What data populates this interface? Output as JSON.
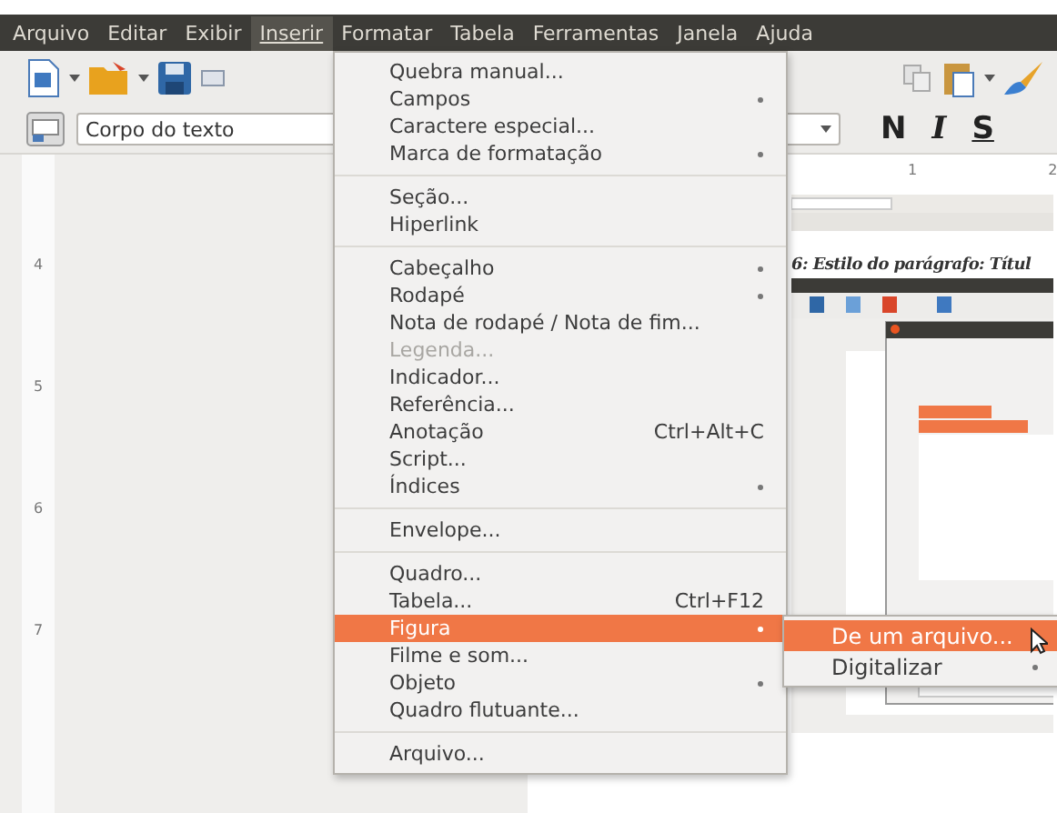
{
  "menubar": [
    {
      "label": "Arquivo",
      "selected": false
    },
    {
      "label": "Editar",
      "selected": false
    },
    {
      "label": "Exibir",
      "selected": false
    },
    {
      "label": "Inserir",
      "selected": true
    },
    {
      "label": "Formatar",
      "selected": false
    },
    {
      "label": "Tabela",
      "selected": false
    },
    {
      "label": "Ferramentas",
      "selected": false
    },
    {
      "label": "Janela",
      "selected": false
    },
    {
      "label": "Ajuda",
      "selected": false
    }
  ],
  "formatting_bar": {
    "paragraph_style": "Corpo do texto",
    "bold": "N",
    "italic": "I",
    "underline": "S"
  },
  "ruler": {
    "top_ticks": [
      "1",
      "2"
    ],
    "left_ticks": [
      "4",
      "5",
      "6",
      "7"
    ]
  },
  "document": {
    "caption": "6: Estilo do parágrafo: Títul"
  },
  "insert_menu": [
    {
      "kind": "item",
      "label": "Quebra manual...",
      "submenu": false,
      "disabled": false,
      "selected": false
    },
    {
      "kind": "item",
      "label": "Campos",
      "submenu": true,
      "disabled": false,
      "selected": false
    },
    {
      "kind": "item",
      "label": "Caractere especial...",
      "submenu": false,
      "disabled": false,
      "selected": false
    },
    {
      "kind": "item",
      "label": "Marca de formatação",
      "submenu": true,
      "disabled": false,
      "selected": false
    },
    {
      "kind": "separator"
    },
    {
      "kind": "item",
      "label": "Seção...",
      "submenu": false,
      "disabled": false,
      "selected": false
    },
    {
      "kind": "item",
      "label": "Hiperlink",
      "submenu": false,
      "disabled": false,
      "selected": false
    },
    {
      "kind": "separator"
    },
    {
      "kind": "item",
      "label": "Cabeçalho",
      "submenu": true,
      "disabled": false,
      "selected": false
    },
    {
      "kind": "item",
      "label": "Rodapé",
      "submenu": true,
      "disabled": false,
      "selected": false
    },
    {
      "kind": "item",
      "label": "Nota de rodapé / Nota de fim...",
      "submenu": false,
      "disabled": false,
      "selected": false
    },
    {
      "kind": "item",
      "label": "Legenda...",
      "submenu": false,
      "disabled": true,
      "selected": false
    },
    {
      "kind": "item",
      "label": "Indicador...",
      "submenu": false,
      "disabled": false,
      "selected": false
    },
    {
      "kind": "item",
      "label": "Referência...",
      "submenu": false,
      "disabled": false,
      "selected": false
    },
    {
      "kind": "item",
      "label": "Anotação",
      "shortcut": "Ctrl+Alt+C",
      "submenu": false,
      "disabled": false,
      "selected": false
    },
    {
      "kind": "item",
      "label": "Script...",
      "submenu": false,
      "disabled": false,
      "selected": false
    },
    {
      "kind": "item",
      "label": "Índices",
      "submenu": true,
      "disabled": false,
      "selected": false
    },
    {
      "kind": "separator"
    },
    {
      "kind": "item",
      "label": "Envelope...",
      "submenu": false,
      "disabled": false,
      "selected": false
    },
    {
      "kind": "separator"
    },
    {
      "kind": "item",
      "label": "Quadro...",
      "submenu": false,
      "disabled": false,
      "selected": false
    },
    {
      "kind": "item",
      "label": "Tabela...",
      "shortcut": "Ctrl+F12",
      "submenu": false,
      "disabled": false,
      "selected": false
    },
    {
      "kind": "item",
      "label": "Figura",
      "submenu": true,
      "disabled": false,
      "selected": true
    },
    {
      "kind": "item",
      "label": "Filme e som...",
      "submenu": false,
      "disabled": false,
      "selected": false
    },
    {
      "kind": "item",
      "label": "Objeto",
      "submenu": true,
      "disabled": false,
      "selected": false
    },
    {
      "kind": "item",
      "label": "Quadro flutuante...",
      "submenu": false,
      "disabled": false,
      "selected": false
    },
    {
      "kind": "separator"
    },
    {
      "kind": "item",
      "label": "Arquivo...",
      "submenu": false,
      "disabled": false,
      "selected": false
    }
  ],
  "figure_submenu": [
    {
      "label": "De um arquivo...",
      "submenu": false,
      "selected": true
    },
    {
      "label": "Digitalizar",
      "submenu": true,
      "selected": false
    }
  ]
}
